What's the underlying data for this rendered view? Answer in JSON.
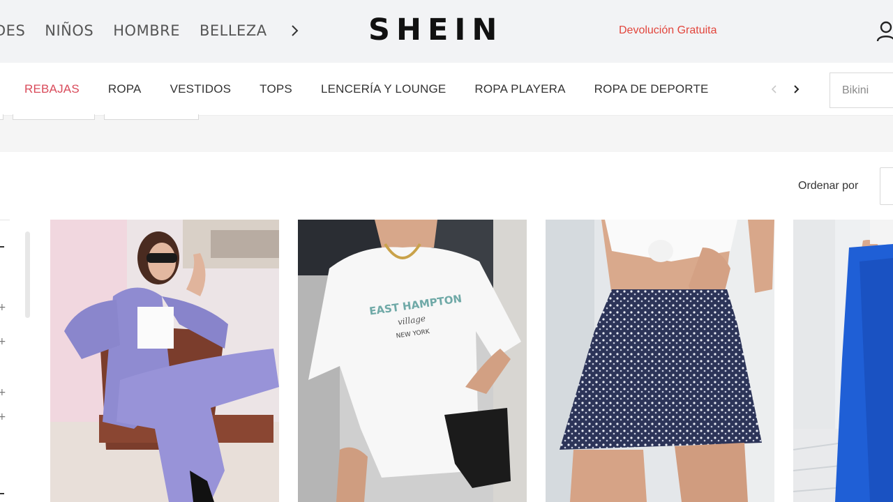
{
  "top_nav": {
    "items": [
      "DES",
      "NIÑOS",
      "HOMBRE",
      "BELLEZA"
    ],
    "next_icon": "chevron-right-icon"
  },
  "brand": {
    "logo": "SHEIN"
  },
  "promo": {
    "text": "Devolución Gratuita",
    "color": "#e2453c"
  },
  "account": {
    "icon": "user-icon"
  },
  "categories": {
    "items": [
      {
        "label": "REBAJAS",
        "highlight": true
      },
      {
        "label": "ROPA",
        "highlight": false
      },
      {
        "label": "VESTIDOS",
        "highlight": false
      },
      {
        "label": "TOPS",
        "highlight": false
      },
      {
        "label": "LENCERÍA Y LOUNGE",
        "highlight": false
      },
      {
        "label": "ROPA PLAYERA",
        "highlight": false
      },
      {
        "label": "ROPA DE DEPORTE",
        "highlight": false
      }
    ],
    "prev_icon": "chevron-left-icon",
    "next_icon": "chevron-right-icon"
  },
  "search": {
    "placeholder": "Bikini"
  },
  "sort": {
    "label": "Ordenar por"
  },
  "products": [
    {
      "image": "woman-lavender-suit"
    },
    {
      "image": "woman-white-graphic-tee",
      "print_line1": "EAST HAMPTON",
      "print_line2": "village",
      "print_line3": "NEW YORK"
    },
    {
      "image": "woman-floral-skort"
    },
    {
      "image": "woman-blue-wide-pants"
    }
  ],
  "colors": {
    "accent": "#d94a5a",
    "topbar_bg": "#f2f3f5"
  }
}
